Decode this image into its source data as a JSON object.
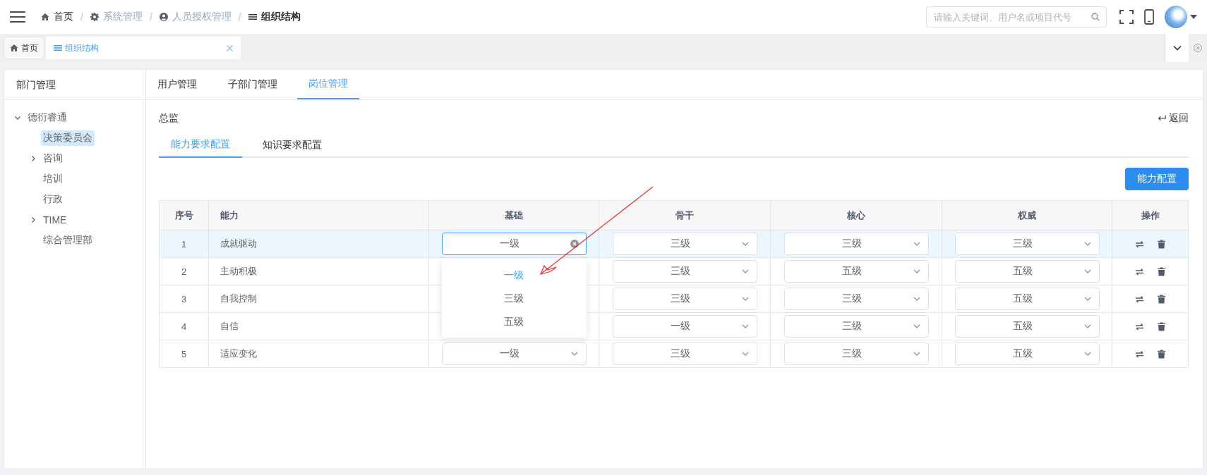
{
  "header": {
    "breadcrumbs": [
      {
        "label": "首页",
        "current": false
      },
      {
        "label": "系统管理",
        "current": false
      },
      {
        "label": "人员授权管理",
        "current": false
      },
      {
        "label": "组织结构",
        "current": true
      }
    ],
    "separator": "/",
    "search": {
      "placeholder": "请输入关键词、用户名或项目代号"
    }
  },
  "tab_bar": {
    "tabs": [
      {
        "label": "首页",
        "selected": false,
        "closable": false
      },
      {
        "label": "组织结构",
        "selected": true,
        "closable": true
      }
    ]
  },
  "sidebar": {
    "title": "部门管理",
    "tree": [
      {
        "label": "德衍睿通",
        "selected": false,
        "expanded": true,
        "children": [
          {
            "label": "决策委员会",
            "selected": true
          },
          {
            "label": "咨询",
            "selected": false,
            "expanded": false
          },
          {
            "label": "培训",
            "selected": false
          },
          {
            "label": "行政",
            "selected": false
          },
          {
            "label": "TIME",
            "selected": false,
            "expanded": false
          },
          {
            "label": "综合管理部",
            "selected": false
          }
        ]
      }
    ]
  },
  "panel": {
    "tabs": [
      {
        "label": "用户管理",
        "selected": false
      },
      {
        "label": "子部门管理",
        "selected": false
      },
      {
        "label": "岗位管理",
        "selected": true
      }
    ],
    "title": "总监",
    "back_link": "返回",
    "sub_tabs": [
      {
        "label": "能力要求配置",
        "selected": true
      },
      {
        "label": "知识要求配置",
        "selected": false
      }
    ],
    "action_button": "能力配置",
    "table": {
      "columns": [
        "序号",
        "能力",
        "基础",
        "骨干",
        "核心",
        "权威",
        "操作"
      ],
      "rows": [
        {
          "index": "1",
          "ability": "成就驱动",
          "highlighted": true,
          "levels": [
            {
              "kind": "select",
              "value": "一级",
              "focused": true,
              "options": [
                {
                  "label": "一级",
                  "selected": true
                },
                {
                  "label": "三级",
                  "selected": false
                },
                {
                  "label": "五级",
                  "selected": false
                }
              ]
            },
            {
              "kind": "select",
              "value": "三级",
              "focused": false
            },
            {
              "kind": "select",
              "value": "三级",
              "focused": false
            },
            {
              "kind": "select",
              "value": "三级",
              "focused": false
            }
          ]
        },
        {
          "index": "2",
          "ability": "主动积极",
          "highlighted": false,
          "levels": [
            {
              "kind": "covered"
            },
            {
              "kind": "select",
              "value": "三级",
              "focused": false
            },
            {
              "kind": "select",
              "value": "五级",
              "focused": false
            },
            {
              "kind": "select",
              "value": "五级",
              "focused": false
            }
          ]
        },
        {
          "index": "3",
          "ability": "自我控制",
          "highlighted": false,
          "levels": [
            {
              "kind": "covered"
            },
            {
              "kind": "select",
              "value": "三级",
              "focused": false
            },
            {
              "kind": "select",
              "value": "三级",
              "focused": false
            },
            {
              "kind": "select",
              "value": "五级",
              "focused": false
            }
          ]
        },
        {
          "index": "4",
          "ability": "自信",
          "highlighted": false,
          "levels": [
            {
              "kind": "covered"
            },
            {
              "kind": "select",
              "value": "一级",
              "focused": false
            },
            {
              "kind": "select",
              "value": "三级",
              "focused": false
            },
            {
              "kind": "select",
              "value": "五级",
              "focused": false
            }
          ]
        },
        {
          "index": "5",
          "ability": "适应变化",
          "highlighted": false,
          "levels": [
            {
              "kind": "select",
              "value": "一级",
              "focused": false
            },
            {
              "kind": "select",
              "value": "三级",
              "focused": false
            },
            {
              "kind": "select",
              "value": "三级",
              "focused": false
            },
            {
              "kind": "select",
              "value": "五级",
              "focused": false
            }
          ]
        }
      ]
    }
  }
}
